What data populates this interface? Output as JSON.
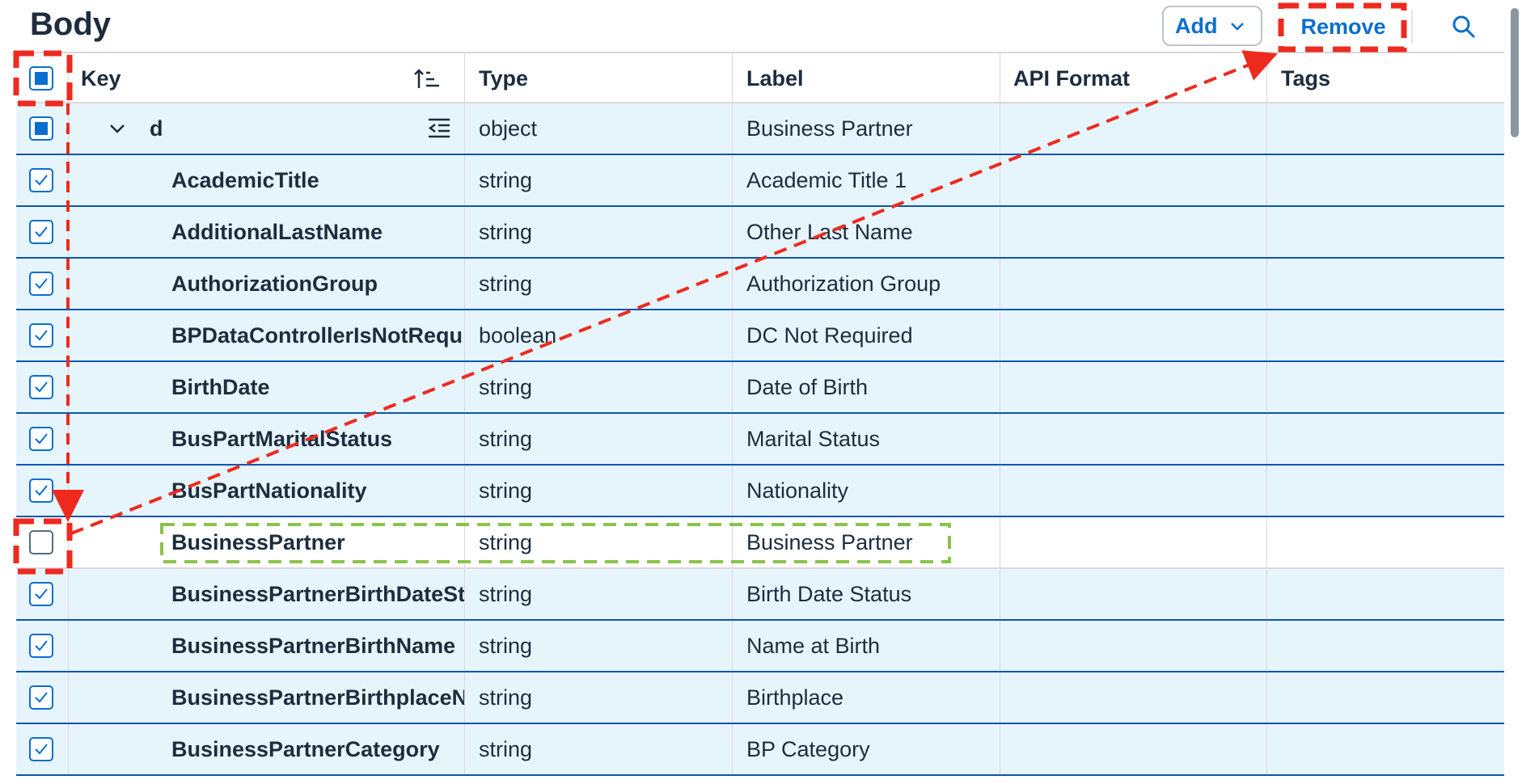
{
  "toolbar": {
    "title": "Body",
    "add_label": "Add",
    "remove_label": "Remove",
    "search_icon": "search-icon"
  },
  "table": {
    "columns": [
      "Key",
      "Type",
      "Label",
      "API Format",
      "Tags"
    ],
    "rows": [
      {
        "key": "d",
        "type": "object",
        "label": "Business Partner",
        "api_format": "",
        "tags": "",
        "checked": "partial",
        "expanded": true
      },
      {
        "key": "AcademicTitle",
        "type": "string",
        "label": "Academic Title 1",
        "api_format": "",
        "tags": "",
        "checked": "checked"
      },
      {
        "key": "AdditionalLastName",
        "type": "string",
        "label": "Other Last Name",
        "api_format": "",
        "tags": "",
        "checked": "checked"
      },
      {
        "key": "AuthorizationGroup",
        "type": "string",
        "label": "Authorization Group",
        "api_format": "",
        "tags": "",
        "checked": "checked"
      },
      {
        "key": "BPDataControllerIsNotRequ",
        "type": "boolean",
        "label": "DC Not Required",
        "api_format": "",
        "tags": "",
        "checked": "checked"
      },
      {
        "key": "BirthDate",
        "type": "string",
        "label": "Date of Birth",
        "api_format": "",
        "tags": "",
        "checked": "checked"
      },
      {
        "key": "BusPartMaritalStatus",
        "type": "string",
        "label": "Marital Status",
        "api_format": "",
        "tags": "",
        "checked": "checked"
      },
      {
        "key": "BusPartNationality",
        "type": "string",
        "label": "Nationality",
        "api_format": "",
        "tags": "",
        "checked": "checked"
      },
      {
        "key": "BusinessPartner",
        "type": "string",
        "label": "Business Partner",
        "api_format": "",
        "tags": "",
        "checked": "unchecked"
      },
      {
        "key": "BusinessPartnerBirthDateSt",
        "type": "string",
        "label": "Birth Date Status",
        "api_format": "",
        "tags": "",
        "checked": "checked"
      },
      {
        "key": "BusinessPartnerBirthName",
        "type": "string",
        "label": "Name at Birth",
        "api_format": "",
        "tags": "",
        "checked": "checked"
      },
      {
        "key": "BusinessPartnerBirthplaceN",
        "type": "string",
        "label": "Birthplace",
        "api_format": "",
        "tags": "",
        "checked": "checked"
      },
      {
        "key": "BusinessPartnerCategory",
        "type": "string",
        "label": "BP Category",
        "api_format": "",
        "tags": "",
        "checked": "checked"
      }
    ]
  },
  "icons": {
    "sort": "sort-ascending-icon",
    "collapse": "collapse-all-icon",
    "expand": "chevron-down-icon",
    "add_dropdown": "chevron-down-icon"
  },
  "colors": {
    "accent": "#0a6ed1",
    "selected_row": "#e6f4fb",
    "annotation_red": "#ee2a1f",
    "annotation_green": "#8bc34a"
  }
}
